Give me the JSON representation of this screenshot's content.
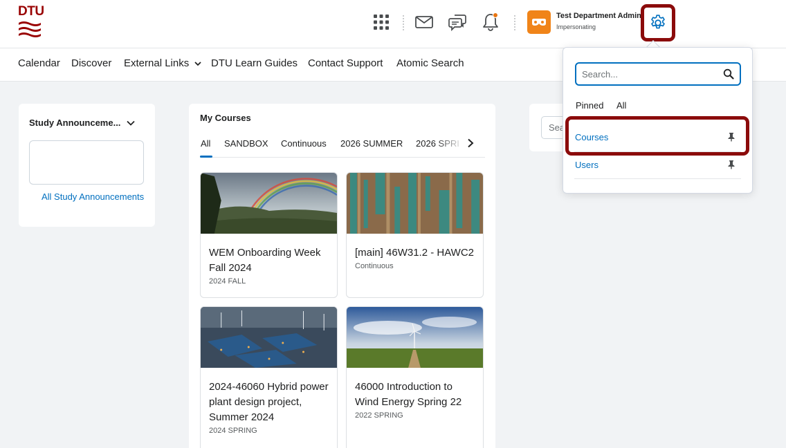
{
  "header": {
    "logo_text": "DTU",
    "user_name": "Test Department Admin",
    "user_status": "Impersonating",
    "colors": {
      "brand_red": "#990000",
      "accent_blue": "#006fbf",
      "highlight": "#8b0b0b",
      "avatar": "#f08419",
      "notification": "#e87511"
    },
    "icons": [
      "apps-grid-icon",
      "mail-icon",
      "chat-icon",
      "bell-icon",
      "settings-gear-icon"
    ]
  },
  "nav": {
    "items": [
      "Calendar",
      "Discover",
      "External Links",
      "DTU Learn Guides",
      "Contact Support",
      "Atomic Search"
    ]
  },
  "announcements": {
    "title": "Study Announceme...",
    "link": "All Study Announcements"
  },
  "my_courses": {
    "title": "My Courses",
    "tabs": [
      "All",
      "SANDBOX",
      "Continuous",
      "2026 SUMMER",
      "2026 SPRI"
    ],
    "active_tab": "All",
    "courses": [
      {
        "name": "WEM Onboarding Week Fall 2024",
        "term": "2024 FALL"
      },
      {
        "name": "[main] 46W31.2 - HAWC2",
        "term": "Continuous"
      },
      {
        "name": "2024-46060 Hybrid power plant design project, Summer 2024",
        "term": "2024 SPRING"
      },
      {
        "name": "46000 Introduction to Wind Energy Spring 22",
        "term": "2022 SPRING"
      }
    ]
  },
  "right_panel": {
    "search_partial": "Sea"
  },
  "admin_dropdown": {
    "search_placeholder": "Search...",
    "tabs": [
      "Pinned",
      "All"
    ],
    "items": [
      "Courses",
      "Users"
    ]
  }
}
